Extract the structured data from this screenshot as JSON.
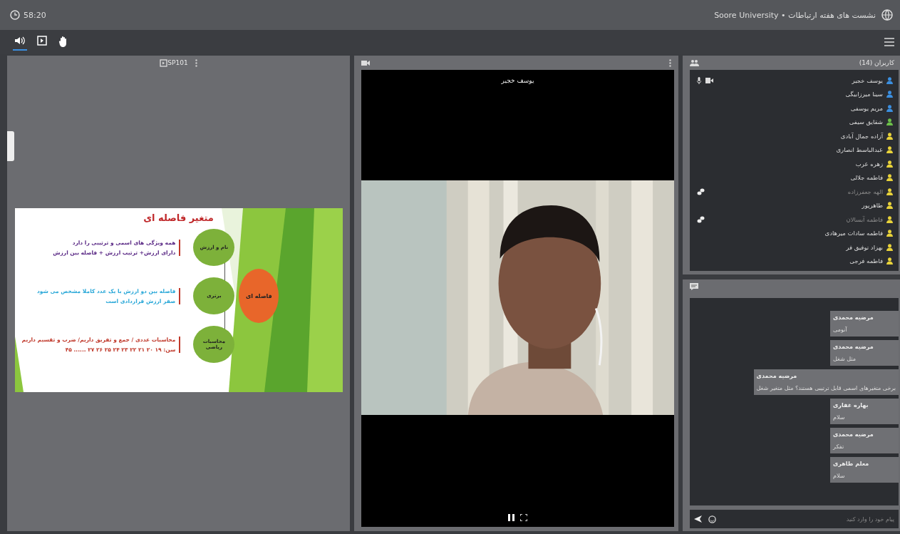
{
  "header": {
    "clock": "58:20",
    "title": "Soore University • نشست های هفته ارتباطات"
  },
  "toolbar": [
    {
      "kind": "speaker",
      "selected": true
    },
    {
      "kind": "screen",
      "selected": false
    },
    {
      "kind": "hand",
      "selected": false
    }
  ],
  "slide_panel": {
    "title": "SP101",
    "slide": {
      "title": "متغیر فاصله ای",
      "center": "فاصله ای",
      "rows": [
        {
          "circle": "نام و ارزش",
          "lines": [
            {
              "text": "همه ویژگی های اسمی و ترتیبی را دارد",
              "color": "#5b2a86"
            },
            {
              "text": "دارای ارزش+ ترتیب ارزش + فاصله بین ارزش",
              "color": "#5b2a86"
            }
          ]
        },
        {
          "circle": "برتری",
          "lines": [
            {
              "text": "فاصله بین دو ارزش با یک عدد کاملا مشخص می شود",
              "color": "#2aa8d8"
            },
            {
              "text": "صفر ارزش قراردادی است",
              "color": "#2aa8d8"
            }
          ]
        },
        {
          "circle": "محاسبات ریاضی",
          "lines": [
            {
              "text": "محاسبات عددی / جمع و تفریق داریم/ ضرب و تقسیم داریم",
              "color": "#c0392b"
            },
            {
              "text": "سن: ۱۹ ۲۰ ۲۱ ۲۲ ۲۳ ۲۴ ۲۵ ۲۶ ۲۷ ...... ۴۵",
              "color": "#c0392b"
            }
          ]
        }
      ]
    }
  },
  "video_panel": {
    "speaker": "یوسف خجیر"
  },
  "participants": {
    "title": "کاربران (14)",
    "users": [
      {
        "name": "یوسف خجیر",
        "color": "#3b8fe0",
        "media": true,
        "away": false
      },
      {
        "name": "سینا میرزابیگی",
        "color": "#3b8fe0",
        "media": false,
        "away": false
      },
      {
        "name": "مریم یوسفی",
        "color": "#3b8fe0",
        "media": false,
        "away": false
      },
      {
        "name": "شقایق سیفی",
        "color": "#6cc04a",
        "media": false,
        "away": false
      },
      {
        "name": "آزاده جمال آبادی",
        "color": "#e8d23a",
        "media": false,
        "away": false
      },
      {
        "name": "عبدالباسط انصاری",
        "color": "#e8d23a",
        "media": false,
        "away": false
      },
      {
        "name": "زهره عرب",
        "color": "#e8d23a",
        "media": false,
        "away": false
      },
      {
        "name": "فاطمه جلالی",
        "color": "#e8d23a",
        "media": false,
        "away": false
      },
      {
        "name": "الهه جعفرزاده",
        "color": "#e8d23a",
        "media": false,
        "away": true
      },
      {
        "name": "طاهرپور",
        "color": "#e8d23a",
        "media": false,
        "away": false
      },
      {
        "name": "فاطمه آبسالان",
        "color": "#e8d23a",
        "media": false,
        "away": true
      },
      {
        "name": "فاطمه سادات میرهادی",
        "color": "#e8d23a",
        "media": false,
        "away": false
      },
      {
        "name": "بهزاد توفیق فر",
        "color": "#e8d23a",
        "media": false,
        "away": false
      },
      {
        "name": "فاطمه فرجی",
        "color": "#e8d23a",
        "media": false,
        "away": false
      }
    ]
  },
  "chat": {
    "messages": [
      {
        "sender": "مرضیه محمدی",
        "text": "آنومی"
      },
      {
        "sender": "مرضیه محمدی",
        "text": "مثل شغل"
      },
      {
        "sender": "مرضیه محمدی",
        "text": "برخی متغیرهای اسمی قابل ترتیبی هستند؟ مثل متغیر شغل"
      },
      {
        "sender": "بهاره غفاری",
        "text": "سلام"
      },
      {
        "sender": "مرضیه محمدی",
        "text": "تفکر"
      },
      {
        "sender": "معلم طاهری",
        "text": "سلام"
      }
    ],
    "placeholder": "پیام خود را وارد کنید"
  }
}
